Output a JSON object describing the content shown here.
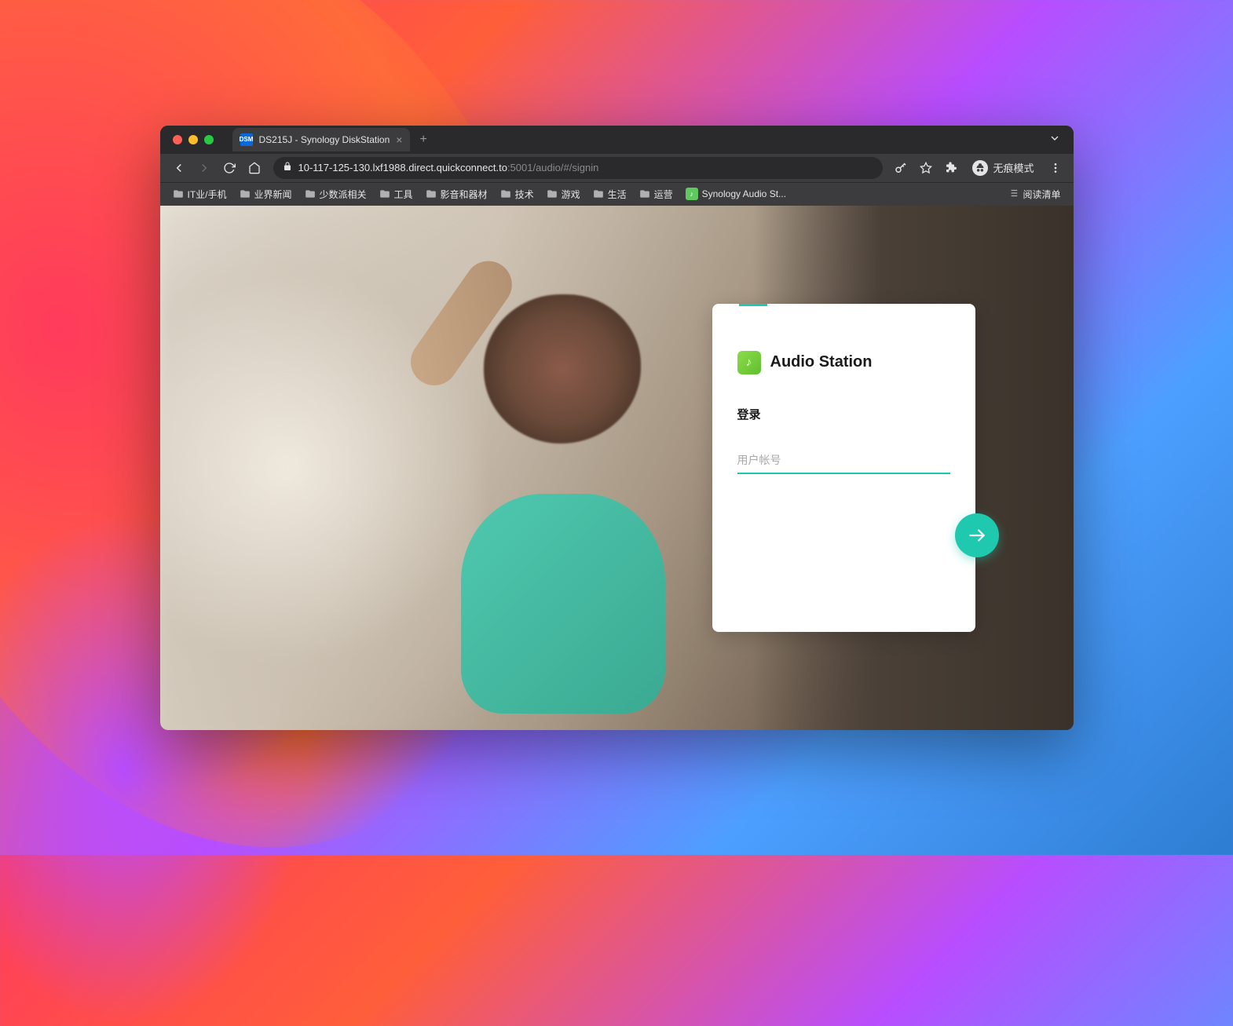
{
  "browser": {
    "tab": {
      "favicon_text": "DSM",
      "title": "DS215J - Synology DiskStation"
    },
    "url": {
      "domain": "10-117-125-130.lxf1988.direct.quickconnect.to",
      "path": ":5001/audio/#/signin"
    },
    "incognito_label": "无痕模式",
    "bookmarks": [
      "IT业/手机",
      "业界新闻",
      "少数派相关",
      "工具",
      "影音和器材",
      "技术",
      "游戏",
      "生活",
      "运营"
    ],
    "bookmark_app": "Synology Audio St...",
    "reading_list": "阅读清单"
  },
  "login": {
    "app_title": "Audio Station",
    "signin_label": "登录",
    "username_placeholder": "用户帐号",
    "username_value": ""
  },
  "colors": {
    "accent": "#1fc9b0",
    "app_icon": "#5fbf2e"
  }
}
